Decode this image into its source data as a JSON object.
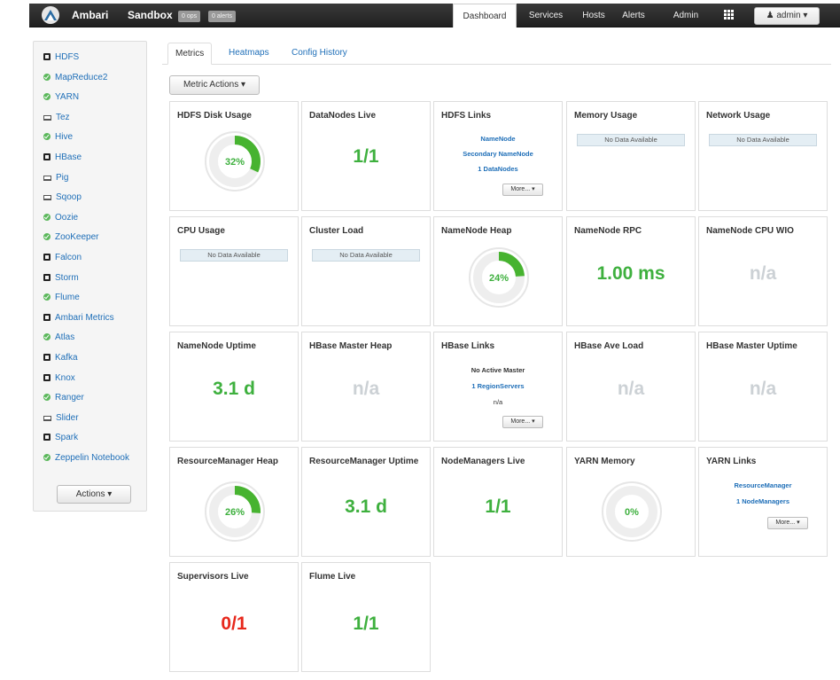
{
  "header": {
    "brand": "Ambari",
    "cluster": "Sandbox",
    "ops_badge": "0 ops",
    "alerts_badge": "0 alerts",
    "nav": [
      "Dashboard",
      "Services",
      "Hosts",
      "Alerts",
      "Admin"
    ],
    "active_nav": "Dashboard",
    "user_label": "admin",
    "icons": [
      "ambari-logo-icon",
      "grid-icon",
      "user-icon",
      "caret-down-icon"
    ]
  },
  "sidebar": {
    "services": [
      {
        "label": "HDFS",
        "status": "box"
      },
      {
        "label": "MapReduce2",
        "status": "ok"
      },
      {
        "label": "YARN",
        "status": "ok"
      },
      {
        "label": "Tez",
        "status": "laptop"
      },
      {
        "label": "Hive",
        "status": "ok"
      },
      {
        "label": "HBase",
        "status": "box"
      },
      {
        "label": "Pig",
        "status": "laptop"
      },
      {
        "label": "Sqoop",
        "status": "laptop"
      },
      {
        "label": "Oozie",
        "status": "ok"
      },
      {
        "label": "ZooKeeper",
        "status": "ok"
      },
      {
        "label": "Falcon",
        "status": "box"
      },
      {
        "label": "Storm",
        "status": "box"
      },
      {
        "label": "Flume",
        "status": "ok"
      },
      {
        "label": "Ambari Metrics",
        "status": "box"
      },
      {
        "label": "Atlas",
        "status": "ok"
      },
      {
        "label": "Kafka",
        "status": "box"
      },
      {
        "label": "Knox",
        "status": "box"
      },
      {
        "label": "Ranger",
        "status": "ok"
      },
      {
        "label": "Slider",
        "status": "laptop"
      },
      {
        "label": "Spark",
        "status": "box"
      },
      {
        "label": "Zeppelin Notebook",
        "status": "ok"
      }
    ],
    "actions_label": "Actions ▾"
  },
  "tabs": [
    "Metrics",
    "Heatmaps",
    "Config History"
  ],
  "active_tab": "Metrics",
  "metric_actions_label": "Metric Actions ▾",
  "no_data": "No Data Available",
  "more_label": "More... ▾",
  "colors": {
    "ok": "#3eb03e",
    "error": "#e7281c",
    "na": "#ccd1d5",
    "link": "#1f6fb8"
  },
  "widgets": {
    "hdfs_disk": {
      "title": "HDFS Disk Usage",
      "percent": 32,
      "label": "32%"
    },
    "datanodes": {
      "title": "DataNodes Live",
      "value": "1/1"
    },
    "hdfs_links": {
      "title": "HDFS Links",
      "links": [
        "NameNode",
        "Secondary NameNode",
        "1 DataNodes"
      ]
    },
    "memory": {
      "title": "Memory Usage"
    },
    "network": {
      "title": "Network Usage"
    },
    "cpu": {
      "title": "CPU Usage"
    },
    "cluster_load": {
      "title": "Cluster Load"
    },
    "nn_heap": {
      "title": "NameNode Heap",
      "percent": 24,
      "label": "24%"
    },
    "nn_rpc": {
      "title": "NameNode RPC",
      "value": "1.00 ms"
    },
    "nn_cpu": {
      "title": "NameNode CPU WIO",
      "value": "n/a"
    },
    "nn_uptime": {
      "title": "NameNode Uptime",
      "value": "3.1 d"
    },
    "hbase_heap": {
      "title": "HBase Master Heap",
      "value": "n/a"
    },
    "hbase_links": {
      "title": "HBase Links",
      "lines": [
        "No Active Master",
        "1 RegionServers",
        "n/a"
      ]
    },
    "hbase_load": {
      "title": "HBase Ave Load",
      "value": "n/a"
    },
    "hbase_uptime": {
      "title": "HBase Master Uptime",
      "value": "n/a"
    },
    "rm_heap": {
      "title": "ResourceManager Heap",
      "percent": 26,
      "label": "26%"
    },
    "rm_uptime": {
      "title": "ResourceManager Uptime",
      "value": "3.1 d"
    },
    "nm_live": {
      "title": "NodeManagers Live",
      "value": "1/1"
    },
    "yarn_mem": {
      "title": "YARN Memory",
      "percent": 0,
      "label": "0%"
    },
    "yarn_links": {
      "title": "YARN Links",
      "links": [
        "ResourceManager",
        "1 NodeManagers"
      ]
    },
    "supervisors": {
      "title": "Supervisors Live",
      "value": "0/1"
    },
    "flume": {
      "title": "Flume Live",
      "value": "1/1"
    }
  }
}
